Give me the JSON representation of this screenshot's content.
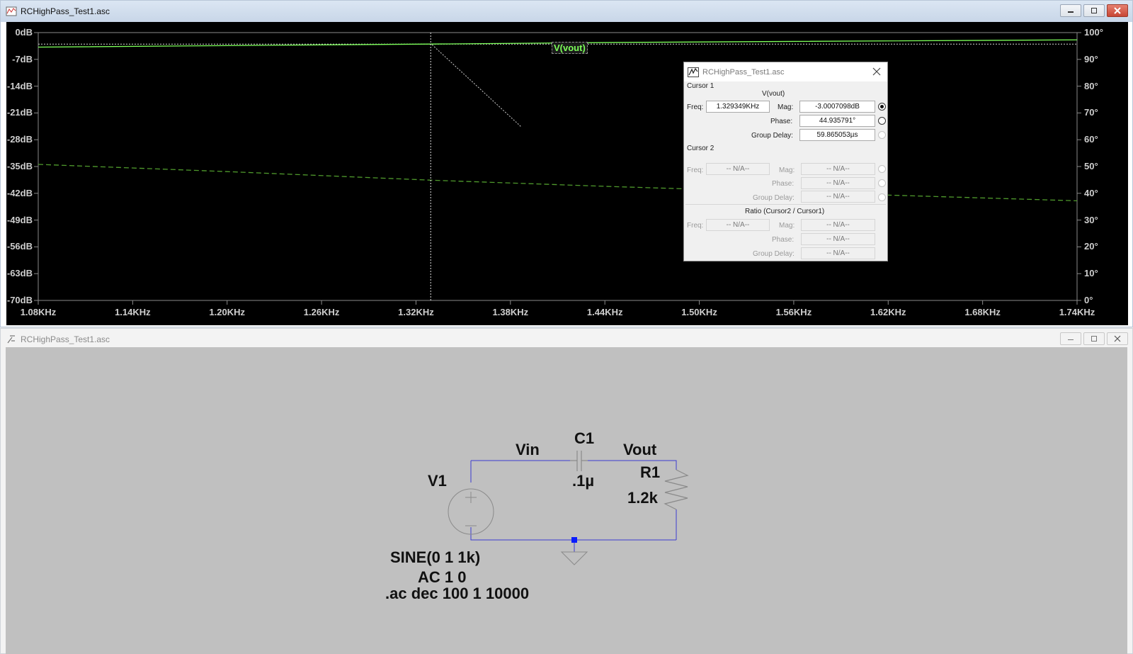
{
  "colors": {
    "plot_background": "#000000",
    "magnitude_trace": "#7dff5a",
    "phase_trace": "#4f9a2c",
    "axis_text": "#cfcfcf",
    "schematic_background": "#c0c0c0",
    "wire": "#3b3bd0"
  },
  "plot_window": {
    "title": "RCHighPass_Test1.asc",
    "icon": "waveform-window-icon",
    "trace_label": "V(vout)",
    "y_left_ticks": [
      "0dB",
      "-7dB",
      "-14dB",
      "-21dB",
      "-28dB",
      "-35dB",
      "-42dB",
      "-49dB",
      "-56dB",
      "-63dB",
      "-70dB"
    ],
    "y_right_ticks": [
      "100°",
      "90°",
      "80°",
      "70°",
      "60°",
      "50°",
      "40°",
      "30°",
      "20°",
      "10°",
      "0°"
    ],
    "x_ticks": [
      "1.08KHz",
      "1.14KHz",
      "1.20KHz",
      "1.26KHz",
      "1.32KHz",
      "1.38KHz",
      "1.44KHz",
      "1.50KHz",
      "1.56KHz",
      "1.62KHz",
      "1.68KHz",
      "1.74KHz"
    ]
  },
  "chart_data": {
    "type": "line",
    "title": "V(vout)",
    "x_unit": "KHz",
    "xlim": [
      1.08,
      1.74
    ],
    "ylim_left": [
      -70,
      0
    ],
    "ylim_right": [
      0,
      100
    ],
    "grid": false,
    "series": [
      {
        "name": "V(vout)",
        "style": "solid",
        "axis": "left",
        "x": [
          1.08,
          1.2,
          1.329349,
          1.44,
          1.56,
          1.74
        ],
        "y": [
          -3.8,
          -3.4,
          -3.0,
          -2.6,
          -2.3,
          -1.9
        ]
      },
      {
        "style": "dashed",
        "axis": "right",
        "x": [
          1.08,
          1.2,
          1.329349,
          1.44,
          1.56,
          1.74
        ],
        "y": [
          50.8,
          48.1,
          44.9,
          42.6,
          40.4,
          37.2
        ]
      }
    ],
    "cursor": {
      "x": 1.329349
    }
  },
  "cursor_dialog": {
    "title": "RCHighPass_Test1.asc",
    "cursor1_header": "Cursor 1",
    "trace_name": "V(vout)",
    "freq_label": "Freq:",
    "freq_value": "1.329349KHz",
    "mag_label": "Mag:",
    "mag_value": "-3.0007098dB",
    "phase_label": "Phase:",
    "phase_value": "44.935791°",
    "group_delay_label": "Group Delay:",
    "group_delay_value": "59.865053µs",
    "cursor2_header": "Cursor 2",
    "na": "-- N/A--",
    "ratio_header": "Ratio (Cursor2 / Cursor1)"
  },
  "schematic_window": {
    "title": "RCHighPass_Test1.asc",
    "icon": "schematic-window-icon",
    "labels": {
      "vin": "Vin",
      "c1": "C1",
      "vout": "Vout",
      "v1": "V1",
      "c1_value": ".1µ",
      "r1": "R1",
      "r1_value": "1.2k",
      "source_spec": "SINE(0 1 1k)",
      "ac_spec": "AC 1 0",
      "ac_directive": ".ac dec 100 1 10000"
    }
  }
}
